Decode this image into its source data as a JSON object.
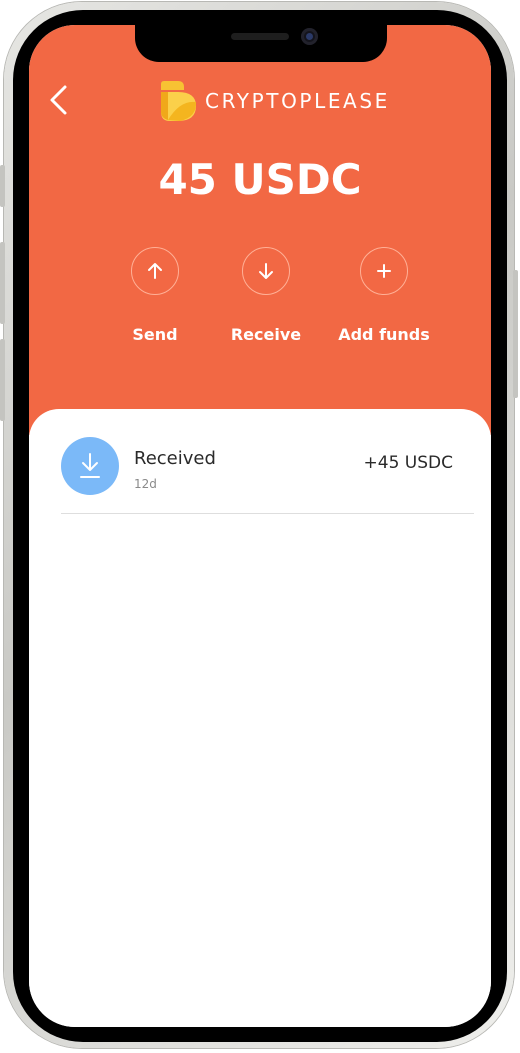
{
  "header": {
    "logo_text": "CRYPTOPLEASE",
    "back_icon": "chevron-left-icon",
    "background_color": "#f26844"
  },
  "wallet": {
    "balance": "45 USDC"
  },
  "actions": [
    {
      "label": "Send",
      "icon": "arrow-up-icon"
    },
    {
      "label": "Receive",
      "icon": "arrow-down-icon"
    },
    {
      "label": "Add funds",
      "icon": "plus-icon"
    }
  ],
  "transactions": [
    {
      "title": "Received",
      "time": "12d",
      "amount": "+45 USDC",
      "icon": "download-icon",
      "icon_color": "#7bb9f8"
    }
  ]
}
